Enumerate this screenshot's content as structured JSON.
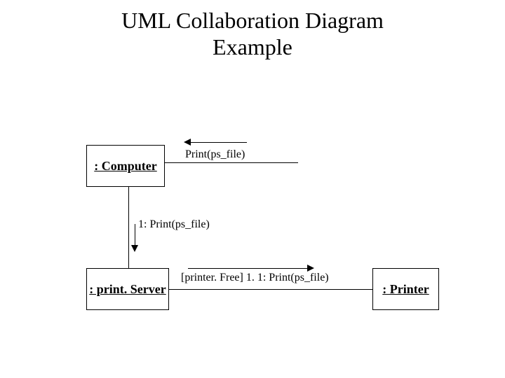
{
  "title_line1": "UML Collaboration Diagram",
  "title_line2": "Example",
  "objects": {
    "computer": ": Computer",
    "printServer": ": print. Server",
    "printer": ": Printer"
  },
  "messages": {
    "to_computer": "Print(ps_file)",
    "computer_to_printserver": "1: Print(ps_file)",
    "printserver_to_printer": "[printer. Free] 1. 1: Print(ps_file)"
  }
}
